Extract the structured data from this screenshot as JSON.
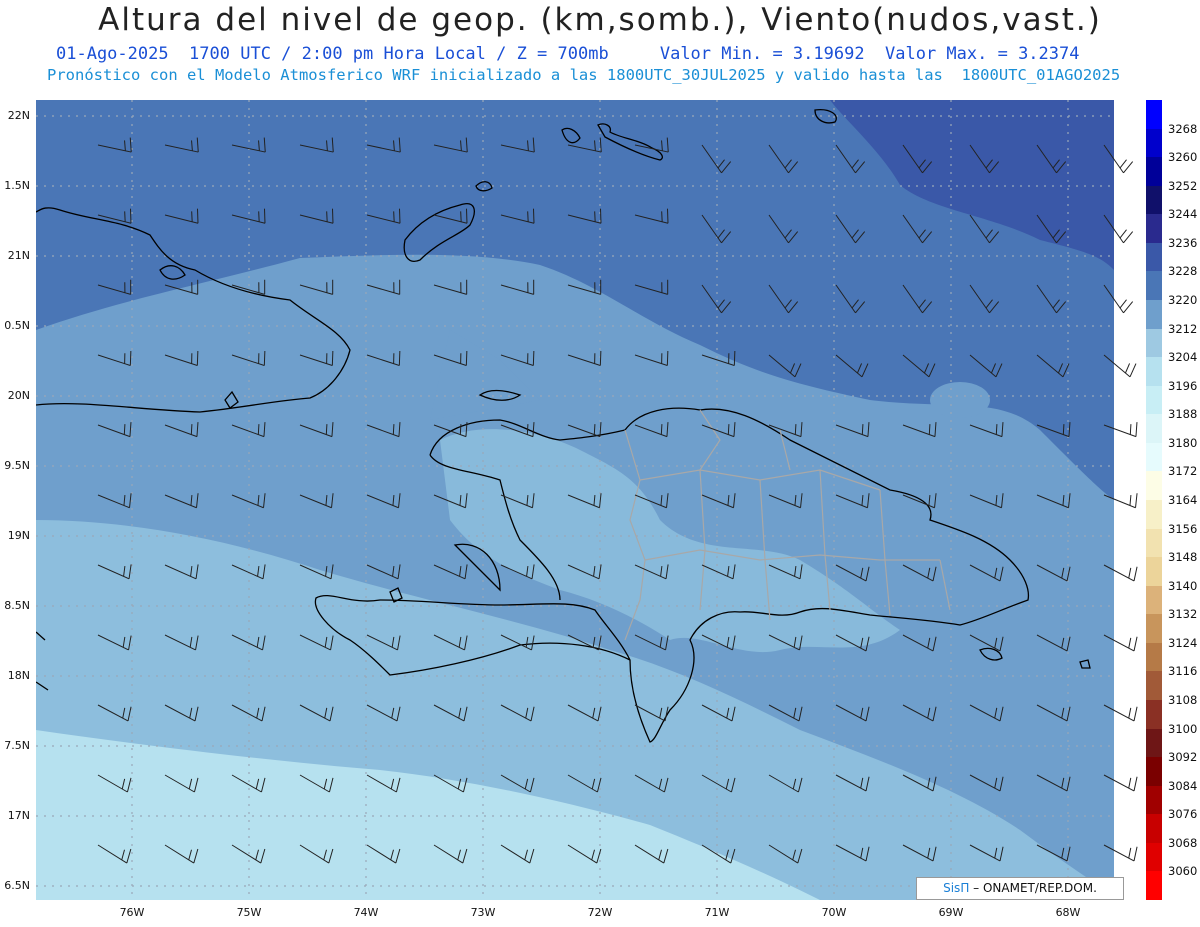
{
  "title": "Altura del nivel de geop. (km,somb.), Viento(nudos,vast.)",
  "subtitle_line1": "01-Ago-2025  1700 UTC / 2:00 pm Hora Local / Z = 700mb     Valor Min. = 3.19692  Valor Max. = 3.2374",
  "subtitle_line2": "Pronóstico con el Modelo Atmosferico WRF inicializado a las 1800UTC_30JUL2025 y valido hasta las  1800UTC_01AGO2025",
  "lat_labels": [
    "22N",
    "1.5N",
    "21N",
    "0.5N",
    "20N",
    "9.5N",
    "19N",
    "8.5N",
    "18N",
    "7.5N",
    "17N",
    "6.5N"
  ],
  "lon_labels": [
    "76W",
    "75W",
    "74W",
    "73W",
    "72W",
    "71W",
    "70W",
    "69W",
    "68W"
  ],
  "colorbar": {
    "labels": [
      "3268",
      "3260",
      "3252",
      "3244",
      "3236",
      "3228",
      "3220",
      "3212",
      "3204",
      "3196",
      "3188",
      "3180",
      "3172",
      "3164",
      "3156",
      "3148",
      "3140",
      "3132",
      "3124",
      "3116",
      "3108",
      "3100",
      "3092",
      "3084",
      "3076",
      "3068",
      "3060"
    ],
    "colors": [
      "#0000ff",
      "#0000cc",
      "#000099",
      "#10106a",
      "#2a2a8e",
      "#3a58a8",
      "#4a76b6",
      "#6f9fcc",
      "#9ec9e2",
      "#b6e1ef",
      "#c8eef5",
      "#dcf5f8",
      "#e6fbfd",
      "#fdfde6",
      "#f7f0c8",
      "#f2e2b0",
      "#ecd49a",
      "#dcb27a",
      "#c8955c",
      "#b57a47",
      "#a15a38",
      "#8a3024",
      "#6e1616",
      "#7a0000",
      "#a00000",
      "#c80000",
      "#e00000",
      "#ff0000"
    ]
  },
  "credit": {
    "brand": "SisΠ",
    "text": "– ONAMET/REP.DOM."
  }
}
